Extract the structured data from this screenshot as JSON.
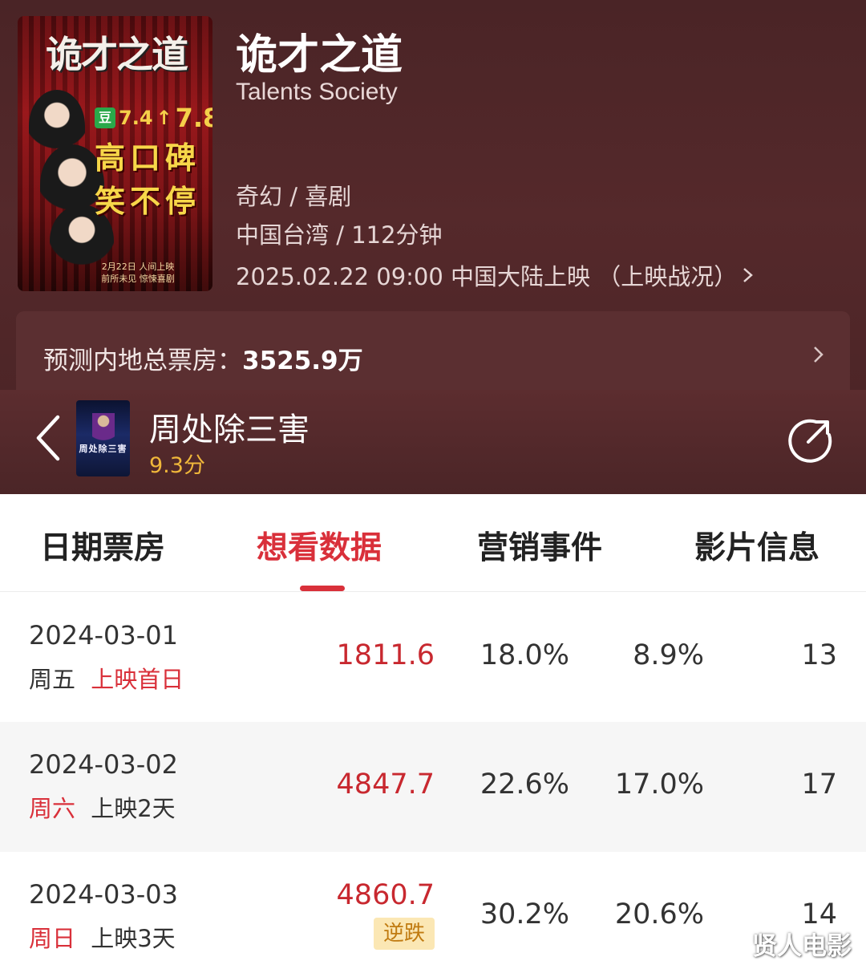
{
  "movie": {
    "poster_title": "诡才之道",
    "poster_rating_from": "7.4",
    "poster_rating_to": "7.8",
    "poster_douban": "豆",
    "poster_slogan_1": "高口碑",
    "poster_slogan_2": "笑不停",
    "poster_date": "2月22日 人间上映",
    "poster_tagline": "前所未见 惊悚喜剧",
    "title": "诡才之道",
    "title_en": "Talents Society",
    "genre": "奇幻 / 喜剧",
    "region_duration": "中国台湾 / 112分钟",
    "release": "2025.02.22 09:00 中国大陆上映 （上映战况）",
    "forecast_label": "预测内地总票房：",
    "forecast_value": "3525.9万"
  },
  "navbar": {
    "title": "周处除三害",
    "score": "9.3分",
    "thumb_text": "周处除三害"
  },
  "tabs": [
    {
      "label": "日期票房",
      "active": false
    },
    {
      "label": "想看数据",
      "active": true
    },
    {
      "label": "营销事件",
      "active": false
    },
    {
      "label": "影片信息",
      "active": false
    }
  ],
  "rows": [
    {
      "date": "2024-03-01",
      "weekday": "周五",
      "note": "上映首日",
      "box": "1811.6",
      "p1": "18.0%",
      "p2": "8.9%",
      "n": "13"
    },
    {
      "date": "2024-03-02",
      "weekday": "周六",
      "note": "上映2天",
      "box": "4847.7",
      "p1": "22.6%",
      "p2": "17.0%",
      "n": "17"
    },
    {
      "date": "2024-03-03",
      "weekday": "周日",
      "note": "上映3天",
      "box": "4860.7",
      "badge": "逆跌",
      "p1": "30.2%",
      "p2": "20.6%",
      "n": "14"
    }
  ],
  "watermark": "贤人电影",
  "colors": {
    "accent_red": "#d9303a",
    "header_bg": "#4a2426",
    "score_gold": "#f0b73a",
    "badge_bg": "#fbe7b4"
  }
}
